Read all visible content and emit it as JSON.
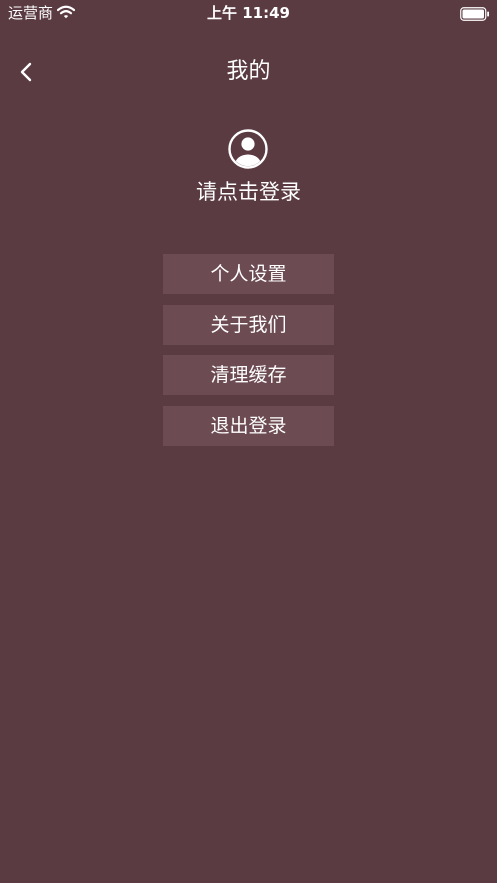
{
  "status_bar": {
    "carrier": "运营商",
    "time": "上午 11:49",
    "wifi_icon": "wifi-icon",
    "battery_icon": "battery-full-icon"
  },
  "nav": {
    "back_icon": "chevron-left-icon",
    "title": "我的"
  },
  "profile": {
    "avatar_icon": "user-circle-icon",
    "login_prompt": "请点击登录"
  },
  "menu": {
    "items": [
      {
        "label": "个人设置"
      },
      {
        "label": "关于我们"
      },
      {
        "label": "清理缓存"
      },
      {
        "label": "退出登录"
      }
    ]
  },
  "colors": {
    "background": "#5a3b42",
    "button": "#6c4b52",
    "text": "#ffffff"
  }
}
